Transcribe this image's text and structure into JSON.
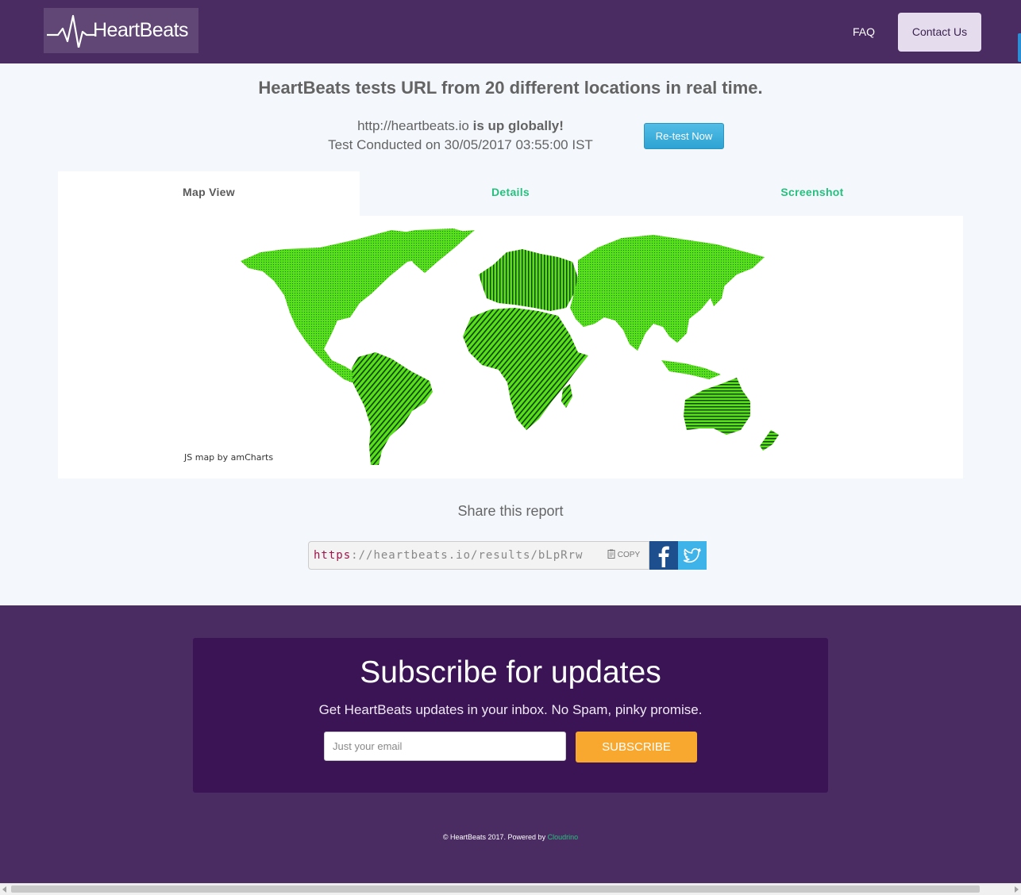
{
  "header": {
    "logo_text": "HeartBeats",
    "nav": {
      "faq": "FAQ",
      "contact": "Contact Us"
    }
  },
  "hero": {
    "headline": "HeartBeats tests URL from 20 different locations in real time.",
    "site_url": "http://heartbeats.io",
    "status": "is up globally!",
    "tested_on": "Test Conducted on 30/05/2017 03:55:00 IST",
    "retest_label": "Re-test Now"
  },
  "tabs": [
    {
      "label": "Map View",
      "active": true
    },
    {
      "label": "Details",
      "active": false
    },
    {
      "label": "Screenshot",
      "active": false
    }
  ],
  "map": {
    "credit": "JS map by amCharts",
    "fill_color": "#55e01b"
  },
  "share": {
    "title": "Share this report",
    "url_protocol": "https",
    "url_rest": "://heartbeats.io/results/bLpRrw",
    "copy_label": "COPY",
    "facebook_icon": "facebook-icon",
    "twitter_icon": "twitter-icon"
  },
  "subscribe": {
    "title": "Subscribe for updates",
    "description": "Get HeartBeats updates in your inbox. No Spam, pinky promise.",
    "email_placeholder": "Just your email",
    "button_label": "SUBSCRIBE"
  },
  "footer": {
    "copyright": "© HeartBeats 2017. Powered by",
    "powered_by": "Cloudrino"
  },
  "colors": {
    "brand_purple": "#4a2c62",
    "card_purple": "#3b1456",
    "accent_green": "#27c07f",
    "subscribe_orange": "#f8a82e",
    "retest_blue": "#3eaedc"
  }
}
